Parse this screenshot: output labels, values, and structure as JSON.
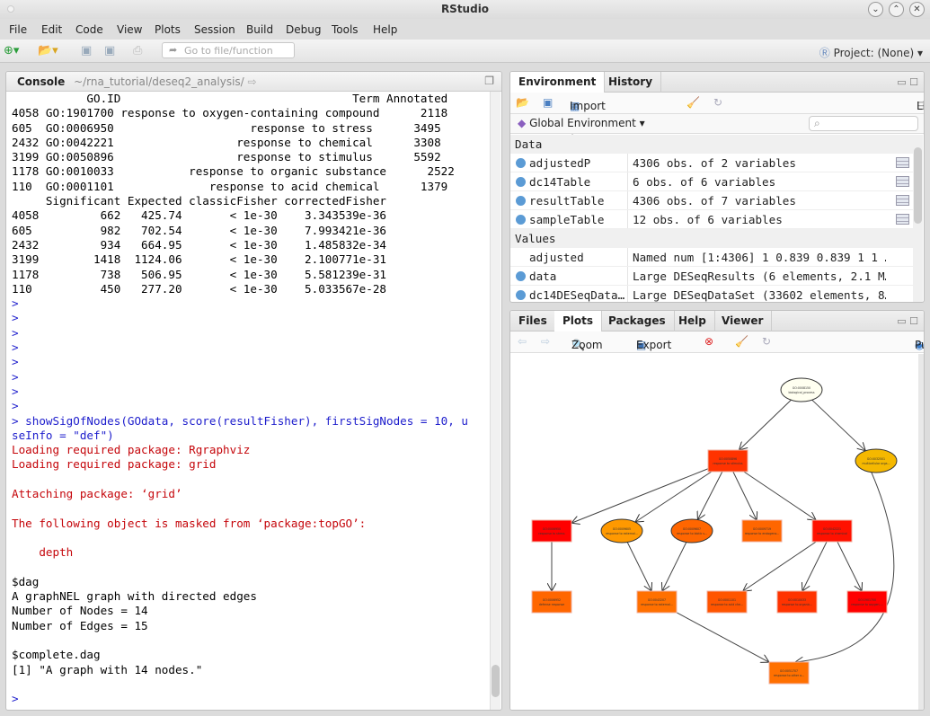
{
  "window": {
    "title": "RStudio",
    "controls": [
      "⌄",
      "⌃",
      "✕"
    ]
  },
  "menu": [
    "File",
    "Edit",
    "Code",
    "View",
    "Plots",
    "Session",
    "Build",
    "Debug",
    "Tools",
    "Help"
  ],
  "toolbar": {
    "goto_placeholder": "Go to file/function",
    "project": "Project: (None)"
  },
  "console": {
    "title": "Console",
    "path": "~/rna_tutorial/deseq2_analysis/",
    "lines": [
      {
        "t": "out",
        "s": "           GO.ID                                  Term Annotated"
      },
      {
        "t": "out",
        "s": "4058 GO:1901700 response to oxygen-containing compound      2118"
      },
      {
        "t": "out",
        "s": "605  GO:0006950                    response to stress      3495"
      },
      {
        "t": "out",
        "s": "2432 GO:0042221                  response to chemical      3308"
      },
      {
        "t": "out",
        "s": "3199 GO:0050896                  response to stimulus      5592"
      },
      {
        "t": "out",
        "s": "1178 GO:0010033           response to organic substance      2522"
      },
      {
        "t": "out",
        "s": "110  GO:0001101              response to acid chemical      1379"
      },
      {
        "t": "out",
        "s": "     Significant Expected classicFisher correctedFisher"
      },
      {
        "t": "out",
        "s": "4058         662   425.74       < 1e-30    3.343539e-36"
      },
      {
        "t": "out",
        "s": "605          982   702.54       < 1e-30    7.993421e-36"
      },
      {
        "t": "out",
        "s": "2432         934   664.95       < 1e-30    1.485832e-34"
      },
      {
        "t": "out",
        "s": "3199        1418  1124.06       < 1e-30    2.100771e-31"
      },
      {
        "t": "out",
        "s": "1178         738   506.95       < 1e-30    5.581239e-31"
      },
      {
        "t": "out",
        "s": "110          450   277.20       < 1e-30    5.033567e-28"
      },
      {
        "t": "in",
        "s": ">"
      },
      {
        "t": "in",
        "s": ">"
      },
      {
        "t": "in",
        "s": ">"
      },
      {
        "t": "in",
        "s": ">"
      },
      {
        "t": "in",
        "s": ">"
      },
      {
        "t": "in",
        "s": ">"
      },
      {
        "t": "in",
        "s": ">"
      },
      {
        "t": "in",
        "s": ">"
      },
      {
        "t": "in",
        "s": "> showSigOfNodes(GOdata, score(resultFisher), firstSigNodes = 10, u"
      },
      {
        "t": "in",
        "s": "seInfo = \"def\")"
      },
      {
        "t": "msg",
        "s": "Loading required package: Rgraphviz"
      },
      {
        "t": "msg",
        "s": "Loading required package: grid"
      },
      {
        "t": "msg",
        "s": ""
      },
      {
        "t": "msg",
        "s": "Attaching package: ‘grid’"
      },
      {
        "t": "msg",
        "s": ""
      },
      {
        "t": "msg",
        "s": "The following object is masked from ‘package:topGO’:"
      },
      {
        "t": "msg",
        "s": ""
      },
      {
        "t": "msg",
        "s": "    depth"
      },
      {
        "t": "out",
        "s": ""
      },
      {
        "t": "out",
        "s": "$dag"
      },
      {
        "t": "out",
        "s": "A graphNEL graph with directed edges"
      },
      {
        "t": "out",
        "s": "Number of Nodes = 14"
      },
      {
        "t": "out",
        "s": "Number of Edges = 15"
      },
      {
        "t": "out",
        "s": ""
      },
      {
        "t": "out",
        "s": "$complete.dag"
      },
      {
        "t": "out",
        "s": "[1] \"A graph with 14 nodes.\""
      },
      {
        "t": "out",
        "s": ""
      },
      {
        "t": "in",
        "s": ">"
      }
    ]
  },
  "environment": {
    "tabs": [
      "Environment",
      "History"
    ],
    "toolbar": {
      "import": "Import Dataset ▾",
      "view": "List ▾"
    },
    "scope": "Global Environment ▾",
    "sections": [
      {
        "title": "Data",
        "rows": [
          {
            "name": "adjustedP",
            "value": "4306 obs. of 2 variables",
            "bullet": true,
            "grid": true
          },
          {
            "name": "dc14Table",
            "value": "6 obs. of 6 variables",
            "bullet": true,
            "grid": true
          },
          {
            "name": "resultTable",
            "value": "4306 obs. of 7 variables",
            "bullet": true,
            "grid": true
          },
          {
            "name": "sampleTable",
            "value": "12 obs. of 6 variables",
            "bullet": true,
            "grid": true
          }
        ]
      },
      {
        "title": "Values",
        "rows": [
          {
            "name": "adjusted",
            "value": "Named num [1:4306] 1 0.839 0.839 1 1 …",
            "bullet": false,
            "grid": false
          },
          {
            "name": "data",
            "value": "Large DESeqResults (6 elements, 2.1 M…",
            "bullet": true,
            "grid": false
          },
          {
            "name": "dc14DESeqData…",
            "value": "Large DESeqDataSet (33602 elements, 8…",
            "bullet": true,
            "grid": false
          }
        ]
      }
    ]
  },
  "plots": {
    "tabs": [
      "Files",
      "Plots",
      "Packages",
      "Help",
      "Viewer"
    ],
    "active_tab": "Plots",
    "toolbar": {
      "zoom": "Zoom",
      "export": "Export ▾",
      "publish": "Publish"
    },
    "graph": {
      "nodes": [
        {
          "id": "GO:0008150",
          "label": "biological_process",
          "shape": "ellipse",
          "color": "#FFFFF0"
        },
        {
          "id": "GO:0050896",
          "label": "response to stimulus",
          "shape": "box",
          "color": "#FF3300"
        },
        {
          "id": "GO:0032501",
          "label": "multicellular orga...",
          "shape": "ellipse",
          "color": "#F5B800"
        },
        {
          "id": "GO:0006950",
          "label": "response to stress",
          "shape": "box",
          "color": "#FF0000"
        },
        {
          "id": "GO:0009605",
          "label": "response to external...",
          "shape": "ellipse",
          "color": "#FF9900"
        },
        {
          "id": "GO:0009607",
          "label": "response to biotic s...",
          "shape": "ellipse",
          "color": "#FF6600"
        },
        {
          "id": "GO:0009719",
          "label": "response to endogeno...",
          "shape": "box",
          "color": "#FF6600"
        },
        {
          "id": "GO:0042221",
          "label": "response to chemical",
          "shape": "box",
          "color": "#FF1100"
        },
        {
          "id": "GO:0006952",
          "label": "defense response",
          "shape": "box",
          "color": "#FF6600"
        },
        {
          "id": "GO:0043207",
          "label": "response to external...",
          "shape": "box",
          "color": "#FF7000"
        },
        {
          "id": "GO:0001101",
          "label": "response to acid che...",
          "shape": "box",
          "color": "#FF5500"
        },
        {
          "id": "GO:0010033",
          "label": "response to organic...",
          "shape": "box",
          "color": "#FF3300"
        },
        {
          "id": "GO:1901700",
          "label": "response to oxygen-...",
          "shape": "box",
          "color": "#FF0000"
        },
        {
          "id": "GO:0051707",
          "label": "response to other o...",
          "shape": "box",
          "color": "#FF7000"
        }
      ],
      "edges": [
        [
          0,
          1
        ],
        [
          0,
          2
        ],
        [
          1,
          3
        ],
        [
          1,
          4
        ],
        [
          1,
          5
        ],
        [
          1,
          6
        ],
        [
          1,
          7
        ],
        [
          3,
          8
        ],
        [
          4,
          9
        ],
        [
          5,
          9
        ],
        [
          7,
          10
        ],
        [
          7,
          11
        ],
        [
          7,
          12
        ],
        [
          9,
          13
        ],
        [
          2,
          13
        ]
      ]
    }
  }
}
